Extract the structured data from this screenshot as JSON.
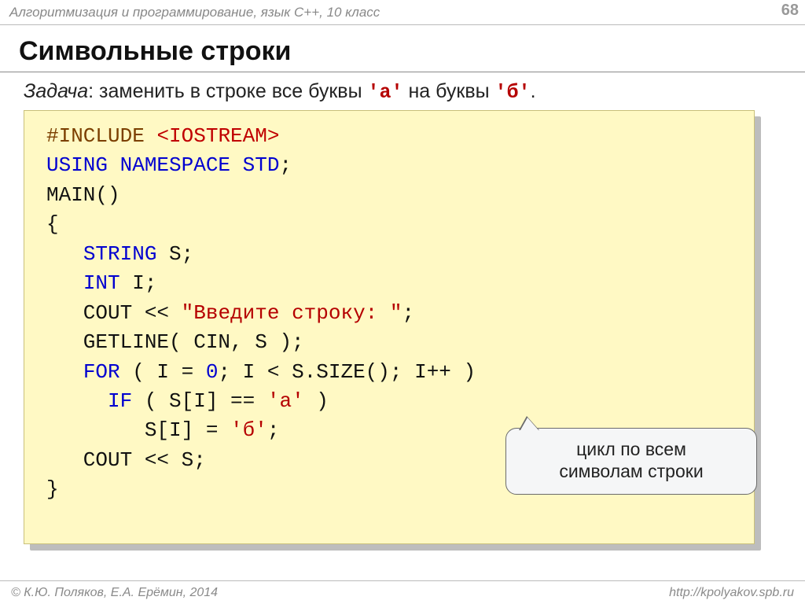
{
  "header": {
    "course": "Алгоритмизация и программирование, язык С++, 10 класс",
    "page_number": "68"
  },
  "title": "Символьные строки",
  "task": {
    "label": "Задача",
    "text_before": ": заменить в строке все буквы ",
    "lit_a": "'а'",
    "text_mid": " на буквы ",
    "lit_b": "'б'",
    "text_after": "."
  },
  "code": {
    "l01a": "#INCLUDE ",
    "l01b": "<IOSTREAM>",
    "l02a": "USING NAMESPACE STD",
    "l02b": ";",
    "l03": "MAIN()",
    "l04": "{",
    "l05a": "   ",
    "l05b": "STRING",
    "l05c": " S;",
    "l06a": "   ",
    "l06b": "INT",
    "l06c": " I;",
    "l07a": "   COUT << ",
    "l07b": "\"Введите строку: \"",
    "l07c": ";",
    "l08": "   GETLINE( CIN, S );",
    "l09a": "   ",
    "l09b": "FOR",
    "l09c": " ( I = ",
    "l09d": "0",
    "l09e": "; I < S.SIZE(); I++ )",
    "l10a": "     ",
    "l10b": "IF",
    "l10c": " ( S[I] == ",
    "l10d": "'а'",
    "l10e": " )",
    "l11a": "        S[I] = ",
    "l11b": "'б'",
    "l11c": ";",
    "l12": "   COUT << S;",
    "l13": "}"
  },
  "callout": {
    "line1": "цикл по всем",
    "line2": "символам строки"
  },
  "footer": {
    "left": "© К.Ю. Поляков, Е.А. Ерёмин, 2014",
    "right": "http://kpolyakov.spb.ru"
  }
}
